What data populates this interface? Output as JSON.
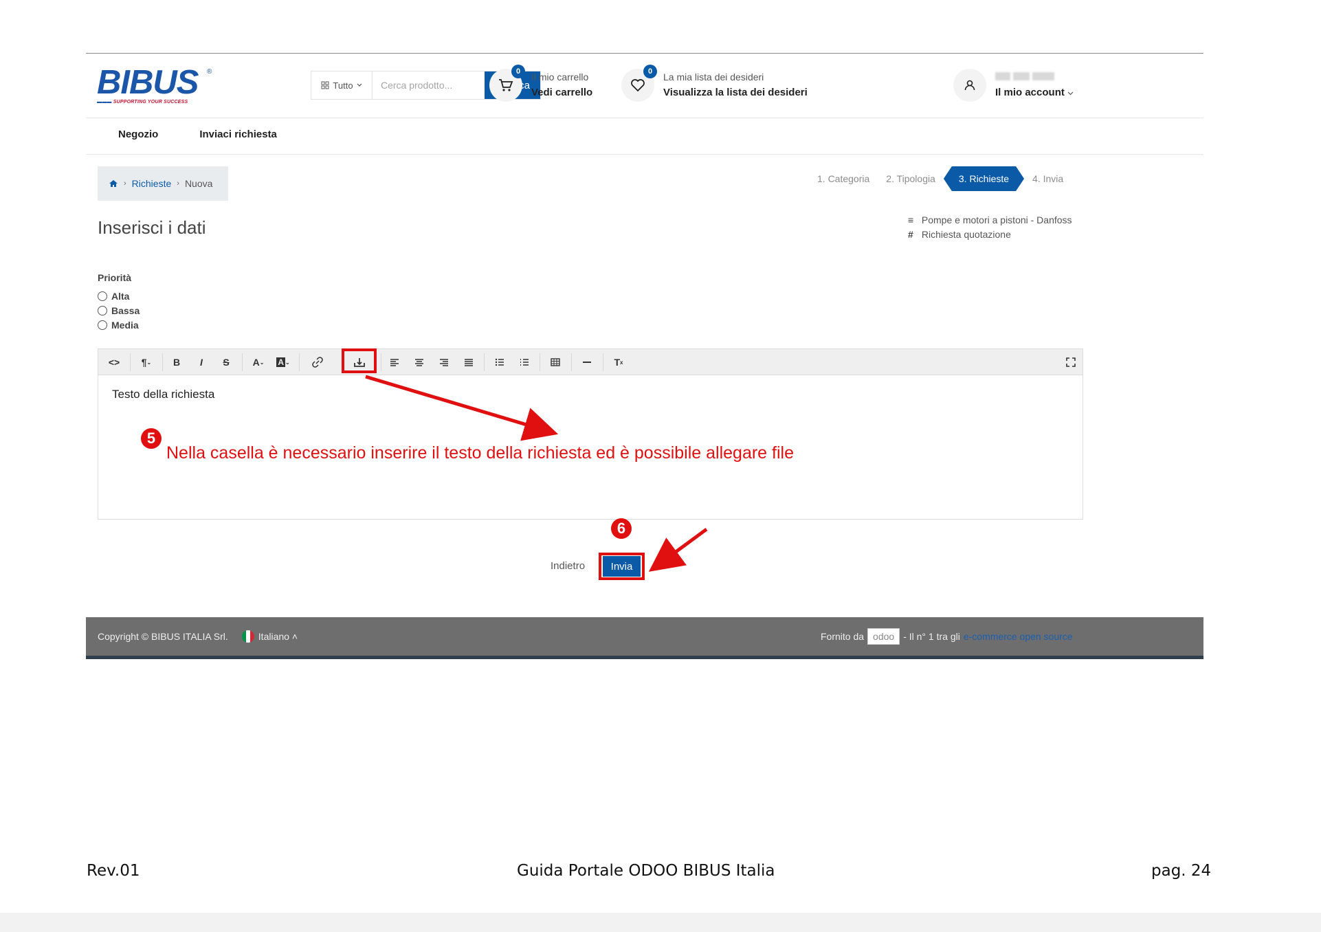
{
  "logo": {
    "brand": "BIBUS",
    "registered": "®",
    "tagline": "SUPPORTING YOUR SUCCESS",
    "color": "#1b56a8",
    "tagline_color": "#c8102e"
  },
  "search": {
    "category": "Tutto",
    "placeholder": "Cerca prodotto...",
    "button": "Ricerca"
  },
  "cart": {
    "count": "0",
    "line1": "Il mio carrello",
    "line2": "Vedi carrello"
  },
  "wishlist": {
    "count": "0",
    "line1": "La mia lista dei desideri",
    "line2": "Visualizza la lista dei desideri"
  },
  "account": {
    "line2": "Il mio account"
  },
  "nav": [
    "Negozio",
    "Inviaci richiesta"
  ],
  "breadcrumb": {
    "link": "Richieste",
    "current": "Nuova"
  },
  "steps": [
    "1. Categoria",
    "2. Tipologia",
    "3. Richieste",
    "4. Invia"
  ],
  "active_step": 2,
  "title": "Inserisci i dati",
  "meta": {
    "category": "Pompe e motori a pistoni - Danfoss",
    "type": "Richiesta quotazione"
  },
  "priority": {
    "label": "Priorità",
    "options": [
      "Alta",
      "Bassa",
      "Media"
    ]
  },
  "editor": {
    "text": "Testo della richiesta"
  },
  "annotations": {
    "five": {
      "number": "5",
      "text": "Nella casella è necessario inserire il testo della richiesta ed è possibile allegare file"
    },
    "six": {
      "number": "6"
    },
    "color": "#e01010"
  },
  "actions": {
    "back": "Indietro",
    "send": "Invia"
  },
  "footer": {
    "copyright": "Copyright © BIBUS ITALIA Srl.",
    "language": "Italiano",
    "powered": "Fornito da",
    "odoo": "odoo",
    "slogan": "- Il n° 1 tra gli",
    "link": "e-commerce open source"
  },
  "doc": {
    "revision": "Rev.01",
    "title": "Guida Portale ODOO BIBUS Italia",
    "page": "pag. 24"
  },
  "colors": {
    "primary": "#0a5aa8",
    "annotation": "#e01010",
    "footer_bg": "#6e6e6e"
  }
}
